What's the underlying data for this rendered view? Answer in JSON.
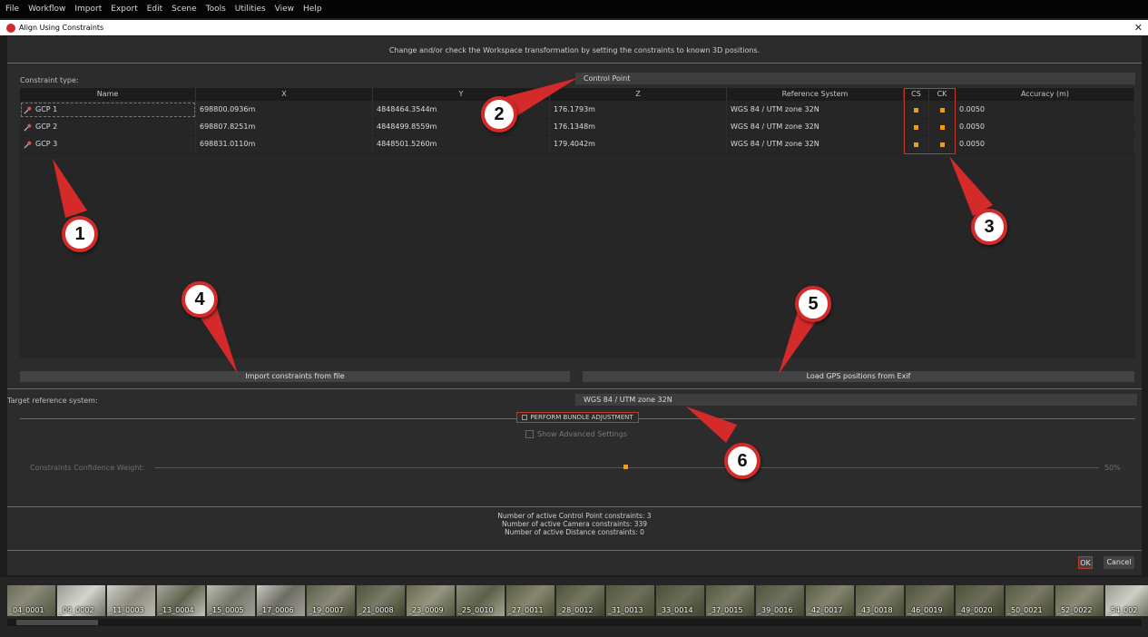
{
  "menu": [
    "File",
    "Workflow",
    "Import",
    "Export",
    "Edit",
    "Scene",
    "Tools",
    "Utilities",
    "View",
    "Help"
  ],
  "window": {
    "title": "Align Using Constraints",
    "close_glyph": "✕"
  },
  "dialog": {
    "header_message": "Change and/or check the Workspace transformation by setting the constraints to known 3D positions.",
    "constraint_type_label": "Constraint type:",
    "constraint_type_value": "Control Point",
    "table": {
      "headers": [
        "Name",
        "X",
        "Y",
        "Z",
        "Reference System",
        "CS",
        "CK",
        "Accuracy (m)"
      ],
      "rows": [
        {
          "name": "GCP 1",
          "x": "698800.0936m",
          "y": "4848464.3544m",
          "z": "176.1793m",
          "ref": "WGS 84 / UTM zone 32N",
          "accuracy": "0.0050"
        },
        {
          "name": "GCP 2",
          "x": "698807.8251m",
          "y": "4848499.8559m",
          "z": "176.1348m",
          "ref": "WGS 84 / UTM zone 32N",
          "accuracy": "0.0050"
        },
        {
          "name": "GCP 3",
          "x": "698831.0110m",
          "y": "4848501.5260m",
          "z": "179.4042m",
          "ref": "WGS 84 / UTM zone 32N",
          "accuracy": "0.0050"
        }
      ]
    },
    "import_button": "Import constraints from file",
    "gps_button": "Load GPS positions from Exif",
    "target_label": "Target reference system:",
    "target_value": "WGS 84 / UTM zone 32N",
    "bundle_label": "PERFORM BUNDLE ADJUSTMENT",
    "advanced_label": "Show Advanced Settings",
    "slider_label": "Constraints Confidence Weight:",
    "slider_value": "50%",
    "slider_fraction": 0.5,
    "stats": [
      "Number of active Control Point constraints: 3",
      "Number of active Camera constraints: 339",
      "Number of active Distance constraints: 0"
    ],
    "ok_label": "OK",
    "cancel_label": "Cancel"
  },
  "filmstrip": [
    "_04_0001",
    "_09_0002",
    "_11_0003",
    "_13_0004",
    "_15_0005",
    "_17_0006",
    "_19_0007",
    "_21_0008",
    "_23_0009",
    "_25_0010",
    "_27_0011",
    "_28_0012",
    "_31_0013",
    "_33_0014",
    "_37_0015",
    "_39_0016",
    "_42_0017",
    "_43_0018",
    "_46_0019",
    "_49_0020",
    "_50_0021",
    "_52_0022",
    "_54_002"
  ],
  "callouts": [
    "1",
    "2",
    "3",
    "4",
    "5",
    "6"
  ],
  "colors": {
    "accent": "#f39c12",
    "highlight": "#c0392b",
    "callout": "#d42a2a"
  }
}
